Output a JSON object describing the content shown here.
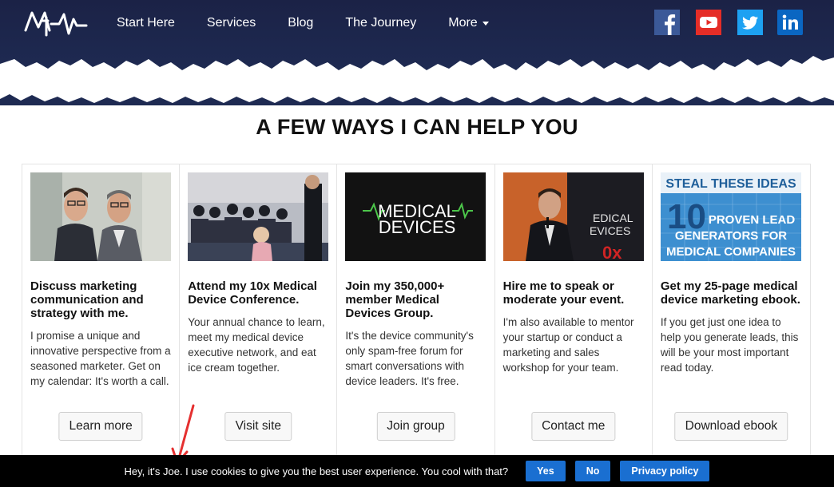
{
  "nav": {
    "items": [
      "Start Here",
      "Services",
      "Blog",
      "The Journey",
      "More"
    ]
  },
  "social": [
    "facebook-icon",
    "youtube-icon",
    "twitter-icon",
    "linkedin-icon"
  ],
  "colors": {
    "header_navy": "#1b2246",
    "button_blue": "#1a6fd1",
    "facebook": "#3b5998",
    "youtube": "#e52d27",
    "twitter": "#1da1f2",
    "linkedin": "#0a66c2"
  },
  "section": {
    "title": "A FEW WAYS I CAN HELP YOU"
  },
  "cards": [
    {
      "image": "photo-two-men",
      "title": "Discuss marketing communication and strategy with me.",
      "body": "I promise a unique and innovative perspective from a seasoned marketer. Get on my calendar: It's worth a call.",
      "button": "Learn more"
    },
    {
      "image": "photo-conference-audience",
      "title": "Attend my 10x Medical Device Conference.",
      "body": "Your annual chance to learn, meet my medical device executive network, and eat ice cream together.",
      "button": "Visit site"
    },
    {
      "image": "medical-devices-logo",
      "image_text": [
        "MEDICAL",
        "DEVICES"
      ],
      "title": "Join my 350,000+ member Medical Devices Group.",
      "body": "It's the device community's only spam-free forum for smart conversations with device leaders. It's free.",
      "button": "Join group"
    },
    {
      "image": "photo-speaker",
      "image_text": [
        "EDICAL",
        "EVICES",
        "0x"
      ],
      "title": "Hire me to speak or moderate your event.",
      "body": "I'm also available to mentor your startup or conduct a marketing and sales workshop for your team.",
      "button": "Contact me"
    },
    {
      "image": "ebook-cover",
      "image_text": [
        "STEAL THESE IDEAS",
        "10",
        "PROVEN LEAD",
        "GENERATORS FOR",
        "MEDICAL COMPANIES"
      ],
      "title": "Get my 25-page medical device marketing ebook.",
      "body": "If you get just one idea to help you generate leads, this will be your most important read today.",
      "button": "Download ebook"
    }
  ],
  "cookie": {
    "message": "Hey, it's Joe. I use cookies to give you the best user experience. You cool with that?",
    "yes": "Yes",
    "no": "No",
    "privacy": "Privacy policy"
  }
}
